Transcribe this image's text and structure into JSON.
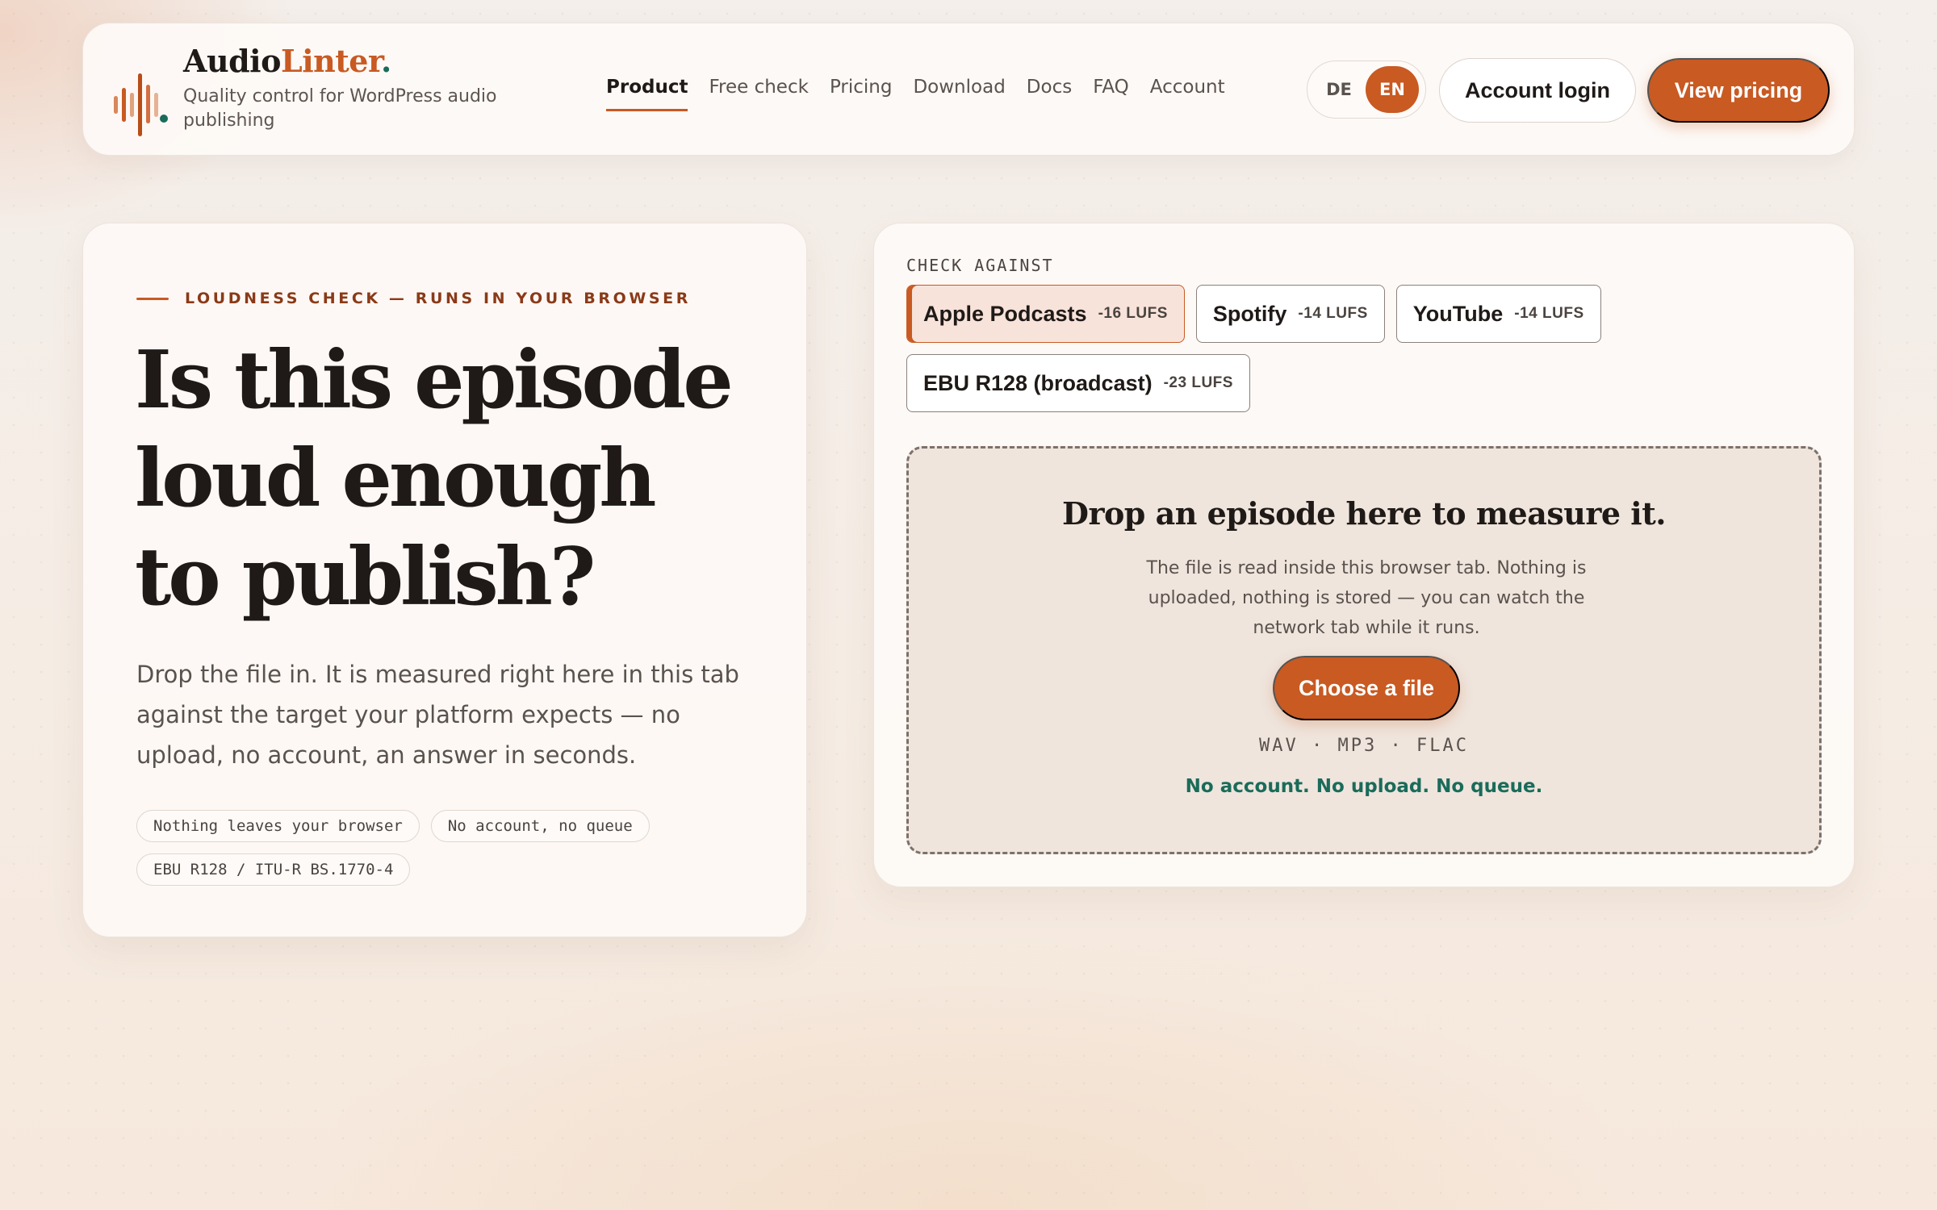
{
  "brand": {
    "name_part1": "Audio",
    "name_part2": "Linter",
    "name_dot": ".",
    "tagline": "Quality control for WordPress audio publishing",
    "logo_icon": "waveform-icon",
    "colors": {
      "accent": "#c85a22",
      "teal": "#1a6b5a",
      "text": "#1f1a17"
    }
  },
  "nav": {
    "items": [
      {
        "label": "Product",
        "active": true
      },
      {
        "label": "Free check",
        "active": false
      },
      {
        "label": "Pricing",
        "active": false
      },
      {
        "label": "Download",
        "active": false
      },
      {
        "label": "Docs",
        "active": false
      },
      {
        "label": "FAQ",
        "active": false
      },
      {
        "label": "Account",
        "active": false
      }
    ]
  },
  "language": {
    "options": [
      "DE",
      "EN"
    ],
    "selected": "EN"
  },
  "header_buttons": {
    "login": "Account login",
    "pricing": "View pricing"
  },
  "hero": {
    "eyebrow": "LOUDNESS CHECK — RUNS IN YOUR BROWSER",
    "headline_lines": [
      "Is this episode",
      "loud enough",
      "to publish?"
    ],
    "lede": "Drop the file in. It is measured right here in this tab against the target your platform expects — no upload, no account, an answer in seconds.",
    "chips": [
      "Nothing leaves your browser",
      "No account, no queue",
      "EBU R128 / ITU-R BS.1770-4"
    ]
  },
  "checker": {
    "label": "CHECK AGAINST",
    "targets": [
      {
        "name": "Apple Podcasts",
        "lufs": "-16 LUFS",
        "active": true
      },
      {
        "name": "Spotify",
        "lufs": "-14 LUFS",
        "active": false
      },
      {
        "name": "YouTube",
        "lufs": "-14 LUFS",
        "active": false
      },
      {
        "name": "EBU R128 (broadcast)",
        "lufs": "-23 LUFS",
        "active": false
      }
    ],
    "dropzone": {
      "title": "Drop an episode here to measure it.",
      "body": "The file is read inside this browser tab. Nothing is uploaded, nothing is stored — you can watch the network tab while it runs.",
      "button": "Choose a file",
      "formats": "WAV · MP3 · FLAC",
      "note": "No account. No upload. No queue."
    }
  }
}
